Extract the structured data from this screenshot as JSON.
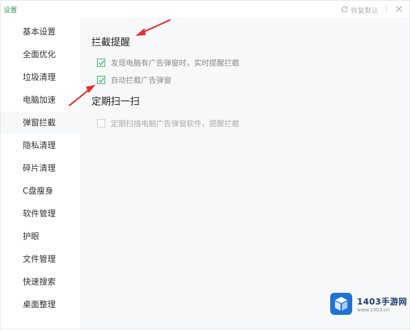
{
  "window": {
    "title": "设置",
    "restore_label": "恢复默认",
    "close_icon": "close-icon",
    "accent_color": "#3aa25f"
  },
  "sidebar": {
    "active_index": 4,
    "items": [
      {
        "label": "基本设置"
      },
      {
        "label": "全面优化"
      },
      {
        "label": "垃圾清理"
      },
      {
        "label": "电脑加速"
      },
      {
        "label": "弹窗拦截"
      },
      {
        "label": "隐私清理"
      },
      {
        "label": "碎片清理"
      },
      {
        "label": "C盘瘦身"
      },
      {
        "label": "软件管理"
      },
      {
        "label": "护眼"
      },
      {
        "label": "文件管理"
      },
      {
        "label": "快速搜索"
      },
      {
        "label": "桌面整理"
      }
    ]
  },
  "main": {
    "section_intercept": {
      "title": "拦截提醒",
      "options": [
        {
          "label": "发现电脑有广告弹窗时，实时提醒拦截",
          "checked": true
        },
        {
          "label": "自动拦截广告弹窗",
          "checked": true
        }
      ]
    },
    "section_scan": {
      "title": "定期扫一扫",
      "options": [
        {
          "label": "定期扫描电脑广告弹窗软件，提醒拦截",
          "checked": false
        }
      ]
    }
  },
  "annotations": {
    "arrow_color": "#e03030"
  },
  "watermark": {
    "name": "1403手游网",
    "url": "www.1403.cn"
  }
}
